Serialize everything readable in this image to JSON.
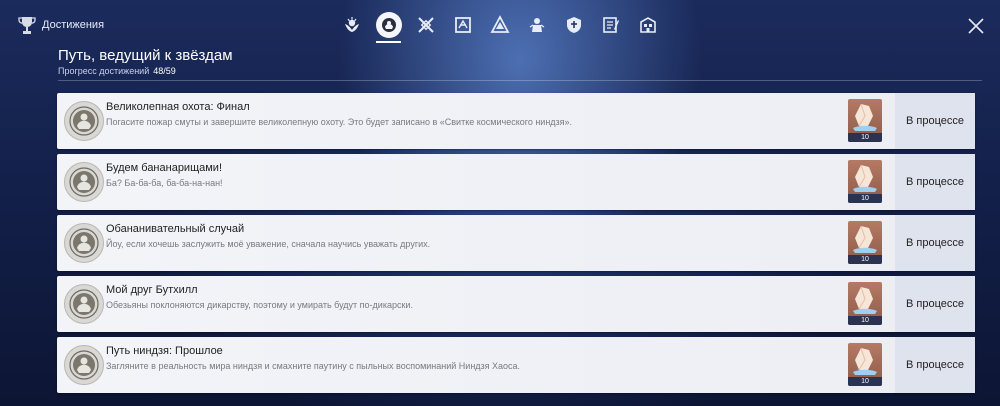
{
  "header": {
    "title": "Достижения",
    "tabs": [
      {
        "id": "tab-1",
        "icon": "flower-emblem-icon",
        "active": false
      },
      {
        "id": "tab-2",
        "icon": "ninja-emblem-icon",
        "active": true
      },
      {
        "id": "tab-3",
        "icon": "crossed-swords-icon",
        "active": false
      },
      {
        "id": "tab-4",
        "icon": "rune-card-icon",
        "active": false
      },
      {
        "id": "tab-5",
        "icon": "triangle-emblem-icon",
        "active": false
      },
      {
        "id": "tab-6",
        "icon": "tower-emblem-icon",
        "active": false
      },
      {
        "id": "tab-7",
        "icon": "shield-emblem-icon",
        "active": false
      },
      {
        "id": "tab-8",
        "icon": "scroll-emblem-icon",
        "active": false
      },
      {
        "id": "tab-9",
        "icon": "building-emblem-icon",
        "active": false
      }
    ]
  },
  "section": {
    "heading": "Путь, ведущий к звёздам",
    "progress_label": "Прогресс достижений",
    "progress_value": "48/59"
  },
  "achievements": [
    {
      "title": "Великолепная охота: Финал",
      "description": "Погасите пожар смуты и завершите великолепную охоту. Это будет записано в «Свитке космического ниндзя».",
      "reward_qty": "10",
      "status": "В процессе"
    },
    {
      "title": "Будем бананарищами!",
      "description": "Ба? Ба-ба-ба, ба-ба-на-нан!",
      "reward_qty": "10",
      "status": "В процессе"
    },
    {
      "title": "Обананивательный случай",
      "description": "Йоу, если хочешь заслужить моё уважение, сначала научись уважать других.",
      "reward_qty": "10",
      "status": "В процессе"
    },
    {
      "title": "Мой друг Бутхилл",
      "description": "Обезьяны поклоняются дикарству, поэтому и умирать будут по-дикарски.",
      "reward_qty": "10",
      "status": "В процессе"
    },
    {
      "title": "Путь ниндзя: Прошлое",
      "description": "Загляните в реальность мира ниндзя и смахните паутину с пыльных воспоминаний Ниндзя Хаоса.",
      "reward_qty": "10",
      "status": "В процессе"
    }
  ],
  "colors": {
    "card_bg": "#f1f2f7",
    "status_bg": "#dfe3ee",
    "reward_bg": "#a16a55",
    "text_dark": "#222222",
    "text_muted": "#777a82"
  }
}
